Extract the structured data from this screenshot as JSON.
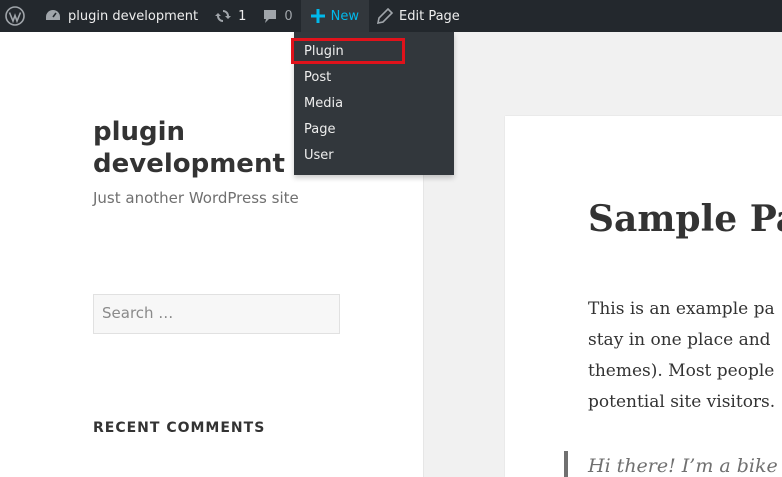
{
  "adminbar": {
    "site_name": "plugin development",
    "updates_count": "1",
    "comments_count": "0",
    "new_label": "New",
    "edit_label": "Edit Page"
  },
  "new_menu": {
    "items": [
      "Plugin",
      "Post",
      "Media",
      "Page",
      "User"
    ],
    "highlighted": "Plugin",
    "highlight_color": "#e0121b"
  },
  "sidebar": {
    "site_title": "plugin development",
    "tagline": "Just another WordPress site",
    "search_placeholder": "Search …",
    "widget_title": "RECENT COMMENTS"
  },
  "page": {
    "title": "Sample Pa",
    "body_lines": [
      "This is an example pa",
      "stay in one place and",
      "themes). Most people",
      "potential site visitors."
    ],
    "quote": "Hi there! I’m a bike"
  },
  "colors": {
    "adminbar_bg": "#23282d",
    "accent": "#00b9eb"
  }
}
